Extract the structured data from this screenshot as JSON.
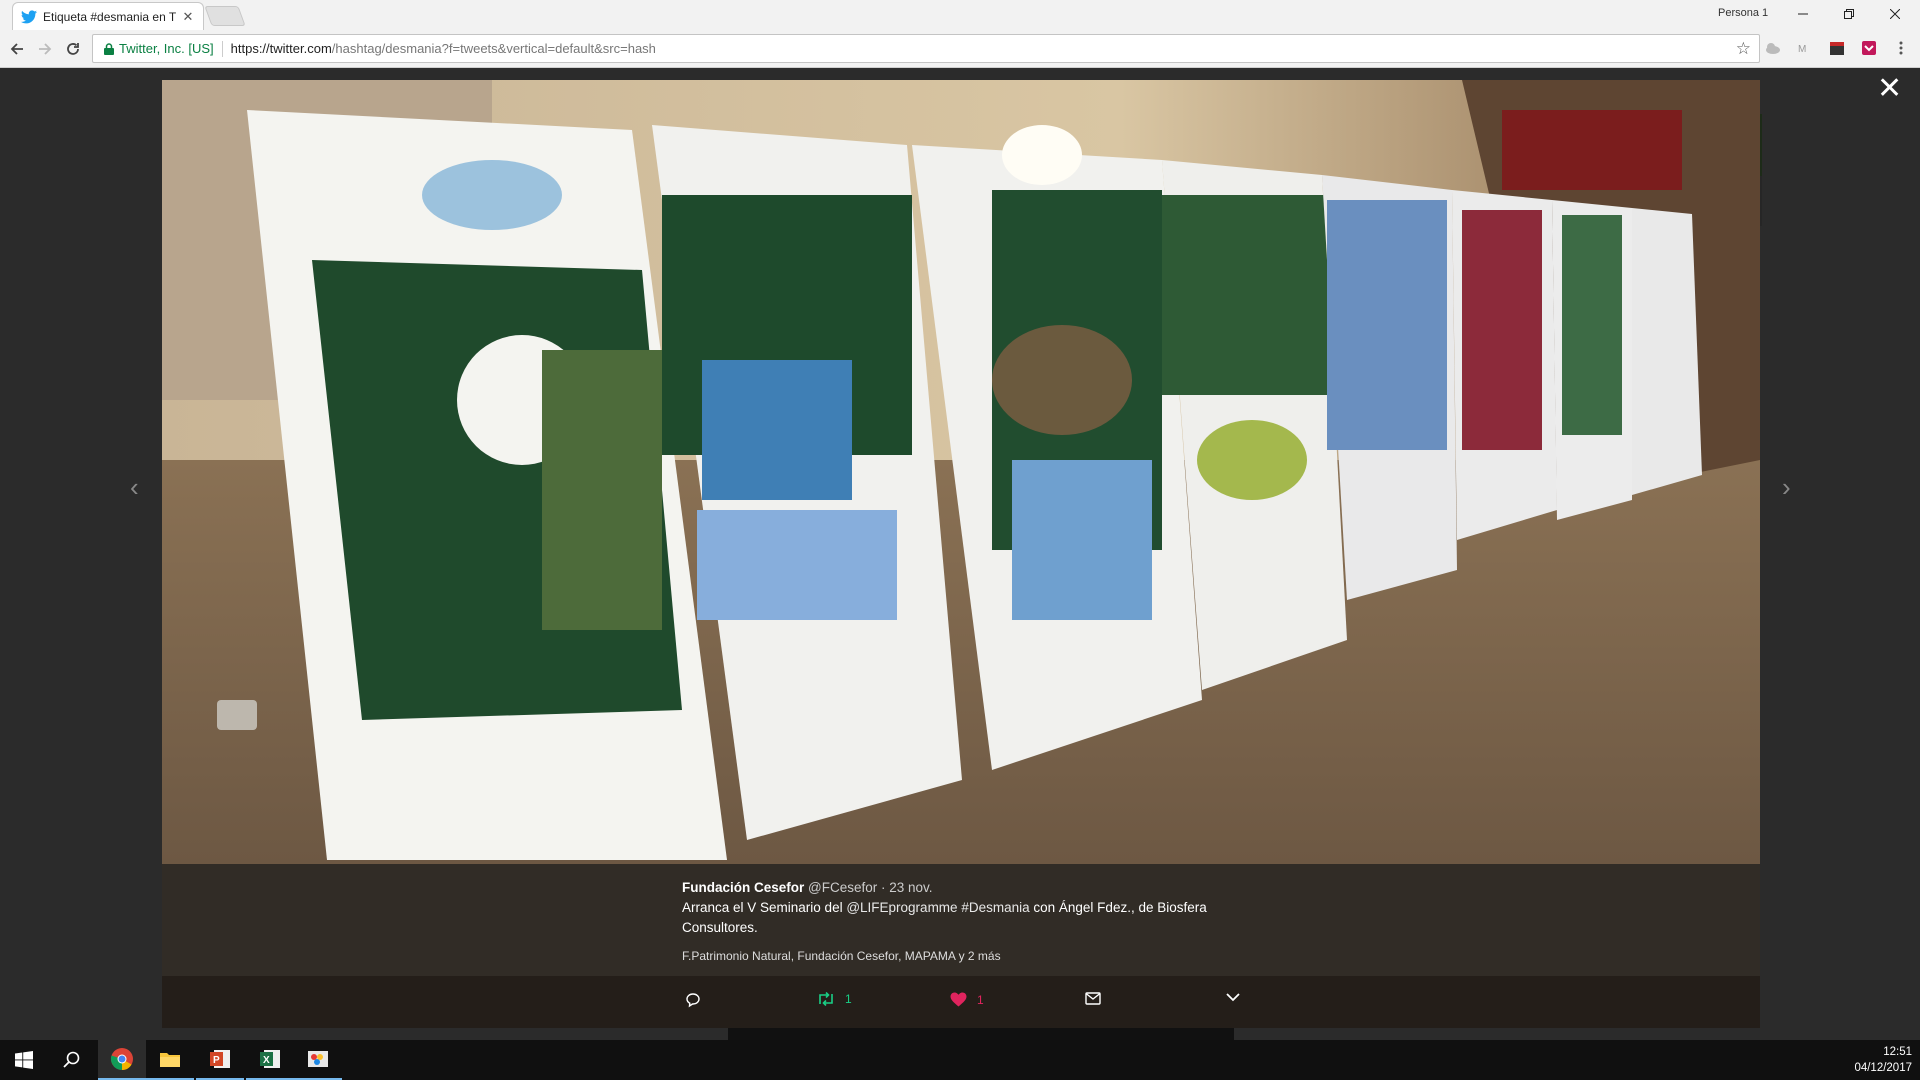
{
  "browser": {
    "tab_title": "Etiqueta #desmania en T",
    "tab_close": "✕",
    "profile": "Persona 1",
    "site_identity": "Twitter, Inc. [US]",
    "url_host": "https://twitter.com",
    "url_path": "/hashtag/desmania?f=tweets&vertical=default&src=hash"
  },
  "viewer": {
    "close_glyph": "✕",
    "prev_glyph": "‹",
    "next_glyph": "›"
  },
  "tweet": {
    "author": "Fundación Cesefor",
    "handle": "@FCesefor",
    "date": "· 23 nov.",
    "text_before": "Arranca el V Seminario del ",
    "mention": "@LIFEprogramme",
    "hashtag": "#Desmania",
    "text_after": " con Ángel Fdez., de Biosfera Consultores.",
    "tagged": "F.Patrimonio Natural, Fundación Cesefor, MAPAMA y 2 más",
    "retweet_count": "1",
    "like_count": "1"
  },
  "colors": {
    "retweet": "#19cf86",
    "like": "#e0245e",
    "site_identity": "#0b8043"
  },
  "taskbar": {
    "time": "12:51",
    "date": "04/12/2017",
    "apps": [
      "start-icon",
      "search-icon",
      "chrome-icon",
      "file-explorer-icon",
      "powerpoint-icon",
      "excel-icon",
      "paint-icon"
    ]
  }
}
